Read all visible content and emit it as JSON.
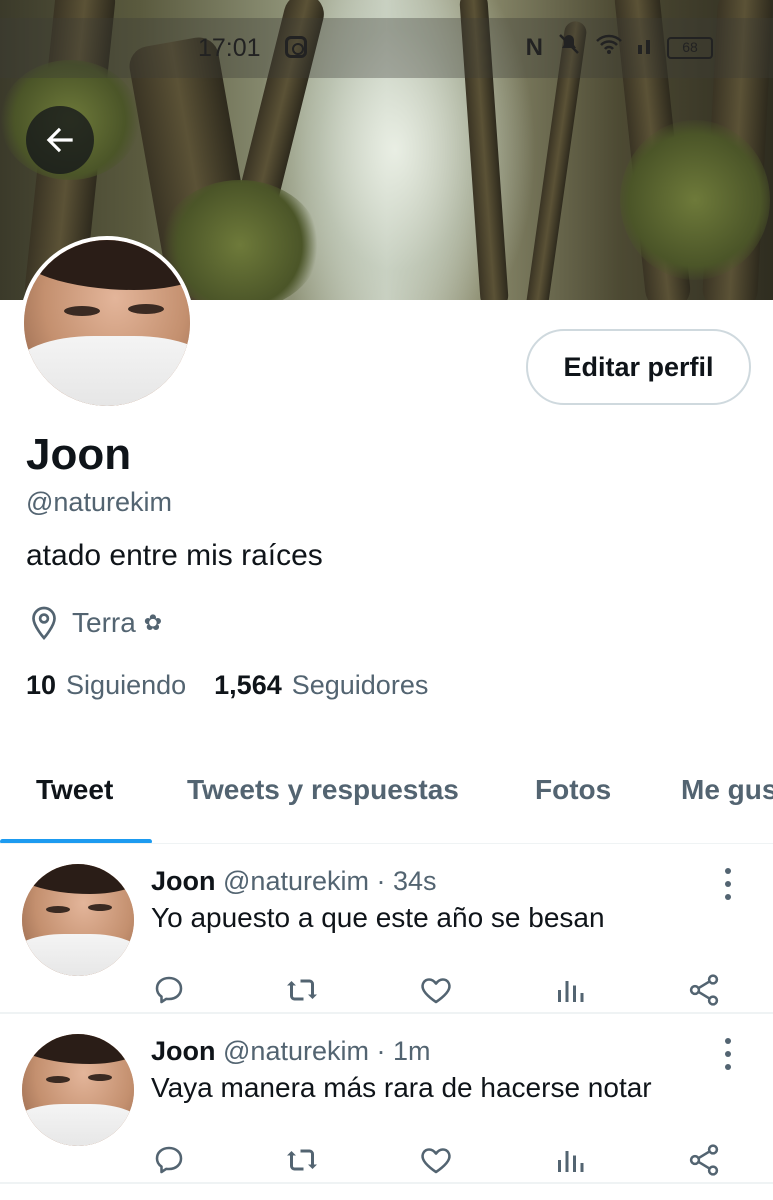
{
  "status_bar": {
    "time": "17:01",
    "battery": "68"
  },
  "profile": {
    "name": "Joon",
    "handle": "@naturekim",
    "bio": "atado entre mis raíces",
    "location": "Terra",
    "edit_button": "Editar perfil",
    "following_count": "10",
    "following_label": "Siguiendo",
    "followers_count": "1,564",
    "followers_label": "Seguidores"
  },
  "tabs": [
    {
      "label": "Tweet",
      "active": true
    },
    {
      "label": "Tweets y respuestas",
      "active": false
    },
    {
      "label": "Fotos",
      "active": false
    },
    {
      "label": "Me gus",
      "active": false
    }
  ],
  "tweets": [
    {
      "name": "Joon",
      "handle": "@naturekim",
      "separator": "·",
      "time": "34s",
      "text": "Yo apuesto a que este año se besan"
    },
    {
      "name": "Joon",
      "handle": "@naturekim",
      "separator": "·",
      "time": "1m",
      "text": "Vaya manera más rara de hacerse notar"
    }
  ],
  "icons": {
    "back": "arrow-left-icon",
    "location": "map-pin-icon",
    "reply": "reply-icon",
    "retweet": "retweet-icon",
    "like": "heart-icon",
    "views": "analytics-icon",
    "share": "share-icon",
    "more": "more-vertical-icon"
  },
  "colors": {
    "accent": "#1d9bf0",
    "text_primary": "#0f1419",
    "text_secondary": "#536471"
  }
}
